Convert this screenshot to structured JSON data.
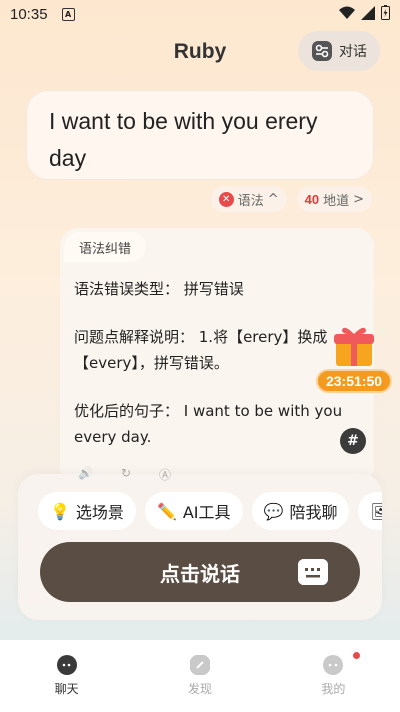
{
  "status_bar": {
    "time": "10:35",
    "notif_letter": "A"
  },
  "header": {
    "title": "Ruby",
    "dialog_label": "对话"
  },
  "user_message": {
    "text": "I want to be with you erery day"
  },
  "feedback_chips": {
    "grammar_label": "语法",
    "grammar_chevron": "^",
    "score": "40",
    "idiomatic_label": "地道",
    "idiomatic_chevron": ">"
  },
  "correction": {
    "tab_label": "语法纠错",
    "error_type": "语法错误类型： 拼写错误",
    "explanation": "问题点解释说明： 1.将【erery】换成【every】，拼写错误。",
    "optimized": "优化后的句子： I want to be with you every day."
  },
  "gift": {
    "timer": "23:51:50"
  },
  "quick_actions": [
    {
      "label": "选场景",
      "icon": "lightbulb-icon"
    },
    {
      "label": "AI工具",
      "icon": "pencil-icon"
    },
    {
      "label": "陪我聊",
      "icon": "chat-bubbles-icon"
    },
    {
      "label": "",
      "icon": "image-icon"
    }
  ],
  "speak": {
    "label": "点击说话"
  },
  "tabbar": {
    "items": [
      {
        "label": "聊天",
        "active": true
      },
      {
        "label": "发现",
        "active": false
      },
      {
        "label": "我的",
        "active": false
      }
    ]
  },
  "colors": {
    "accent_brown": "#5a4d43",
    "error_red": "#e94949",
    "timer_orange": "#f49a1e"
  }
}
